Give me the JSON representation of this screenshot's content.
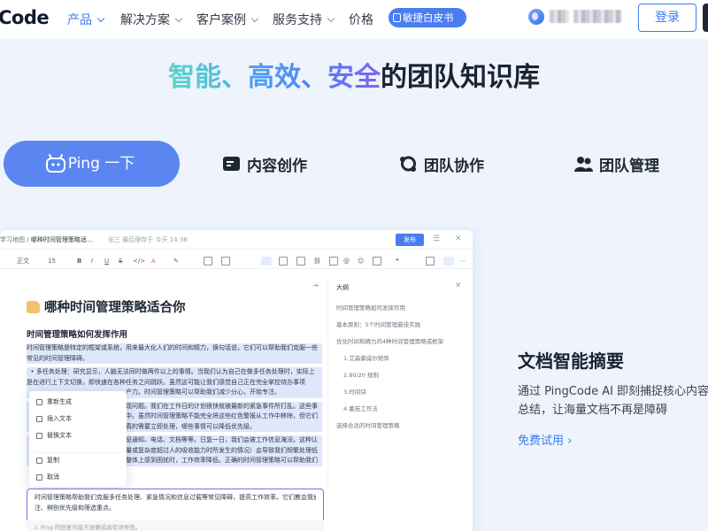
{
  "nav": {
    "logo": "Code",
    "items": [
      {
        "label": "产品",
        "active": true
      },
      {
        "label": "解决方案"
      },
      {
        "label": "客户案例"
      },
      {
        "label": "服务支持"
      },
      {
        "label": "价格"
      }
    ],
    "whitepaper": "敏捷白皮书",
    "login": "登录",
    "colors": {
      "accent": "#3a7bf6"
    }
  },
  "hero": {
    "part1": "智能、",
    "part2": "高效、",
    "part3": "安全",
    "part4": "的团队知识库"
  },
  "tabs": {
    "ping": "Ping 一下",
    "content": "内容创作",
    "collab": "团队协作",
    "manage": "团队管理"
  },
  "editor": {
    "breadcrumb_prefix": "学习地图 /",
    "doc_name": "哪种时间管理策略适...",
    "meta": "张三 最后保存于 今天 14:38",
    "publish": "发布",
    "toolbar": {
      "style": "正文",
      "size": "15"
    },
    "h1": "哪种时间管理策略适合你",
    "h2": "时间管理策略如何发挥作用",
    "p1": [
      "时间管理策略是特定的框架或系统，用来最大化人们的时间和精力，换句话说，它们可以帮助我们克服一些",
      "常见的时间管理障碍。"
    ],
    "bullet": "多任务处理：研究显示，人脑无法同时做两件以上的事情。当我们认为自己在做多任务处理时，实际上",
    "p2": [
      "是在进行上下文切换，即快速在各种任务之间跳跃。虽然这可能让我们感觉自己正在完全掌控待办事项",
      "产力。时间管理策略可以帮助我们减少分心，开始专注。",
      "现问题。我们在工作日的计划很快就被最新的紧急事件所打乱。这些事",
      "中。虽然时间管理策略不能完全将这些红色警报从工作中移除，但它们",
      "真的需要立即处理，哪些事情可以降低优先级。",
      "息通知、电话、文档等等。日复一日，我们会被工作信息淹没。这种认",
      "量或复杂度超过人的吸收能力时所发生的情况）会导致我们频繁处理低",
      "整体上感到困扰时，工作效率降低。正确的时间管理策略可以帮助我们"
    ],
    "context_menu": [
      "重新生成",
      "插入文本",
      "替换文本",
      "复制",
      "取消"
    ],
    "ai_text": [
      "时间管理策略帮助我们克服多任务处理、紧急情况和信息过载等常见障碍，提高工作效率。它们教会我们专",
      "注、辨别优先级和筛选重点。"
    ],
    "ai_note": "Ping 的回复可能不准确或具有误导性。",
    "outline": {
      "title": "大纲",
      "items": [
        "时间管理策略如何发挥作用",
        "基本原则：5个时间管理最佳实践",
        "优化时间和精力的4种时间管理策略或框架",
        "1.艾森豪威尔矩阵",
        "2.80/20 规则",
        "3.时间块",
        "4.番茄工作法",
        "选择合适的时间管理策略"
      ]
    }
  },
  "feature": {
    "title": "文档智能摘要",
    "desc": [
      "通过 PingCode AI 即刻捕捉核心内容，",
      "总结，让海量文档不再是障碍"
    ],
    "link": "免费试用 ›"
  }
}
